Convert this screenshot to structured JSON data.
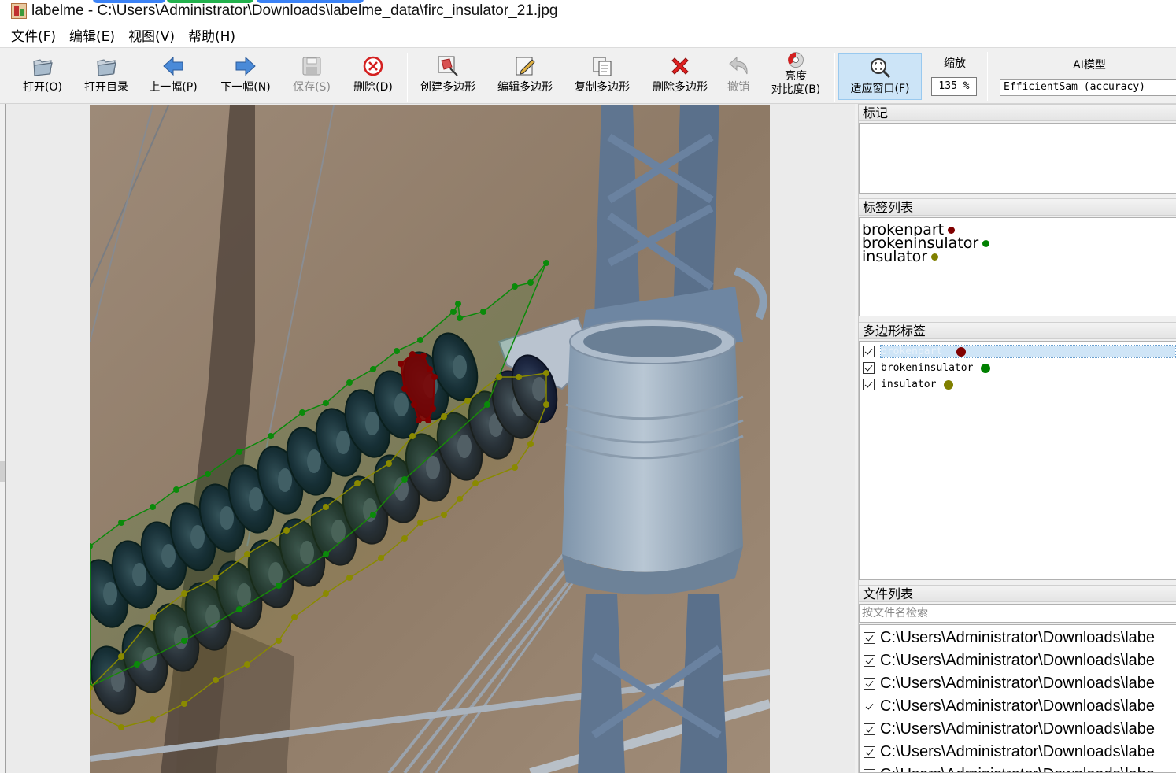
{
  "window": {
    "title": "labelme - C:\\Users\\Administrator\\Downloads\\labelme_data\\firc_insulator_21.jpg"
  },
  "menu": [
    {
      "label": "文件(F)"
    },
    {
      "label": "编辑(E)"
    },
    {
      "label": "视图(V)"
    },
    {
      "label": "帮助(H)"
    }
  ],
  "toolbar": {
    "open": "打开(O)",
    "open_dir": "打开目录",
    "prev": "上一幅(P)",
    "next": "下一幅(N)",
    "save": "保存(S)",
    "delete_file": "删除(D)",
    "create_polygon": "创建多边形",
    "edit_polygon": "编辑多边形",
    "copy_polygon": "复制多边形",
    "delete_polygon": "删除多边形",
    "undo": "撤销",
    "brightness_line1": "亮度",
    "brightness_line2": "对比度(B)",
    "fit_window": "适应窗口(F)",
    "zoom_label": "缩放",
    "zoom_value": "135 %",
    "ai_label": "AI模型",
    "ai_model": "EfficientSam (accuracy)"
  },
  "colors": {
    "brokenpart": "#800000",
    "brokeninsulator": "#008000",
    "insulator": "#808000"
  },
  "dock": {
    "flags_title": "标记",
    "labels_title": "标签列表",
    "labels": [
      {
        "name": "brokenpart",
        "color": "#800000"
      },
      {
        "name": "brokeninsulator",
        "color": "#008000"
      },
      {
        "name": "insulator",
        "color": "#808000"
      }
    ],
    "polygons_title": "多边形标签",
    "polygons": [
      {
        "name": "brokenpart",
        "color": "#800000",
        "checked": true,
        "selected": true
      },
      {
        "name": "brokeninsulator",
        "color": "#008000",
        "checked": true,
        "selected": false
      },
      {
        "name": "insulator",
        "color": "#808000",
        "checked": true,
        "selected": false
      }
    ],
    "files_title": "文件列表",
    "files_search_placeholder": "按文件名检索",
    "files": [
      "C:\\Users\\Administrator\\Downloads\\labe",
      "C:\\Users\\Administrator\\Downloads\\labe",
      "C:\\Users\\Administrator\\Downloads\\labe",
      "C:\\Users\\Administrator\\Downloads\\labe",
      "C:\\Users\\Administrator\\Downloads\\labe",
      "C:\\Users\\Administrator\\Downloads\\labe",
      "C:\\Users\\Administrator\\Downloads\\labe"
    ]
  }
}
